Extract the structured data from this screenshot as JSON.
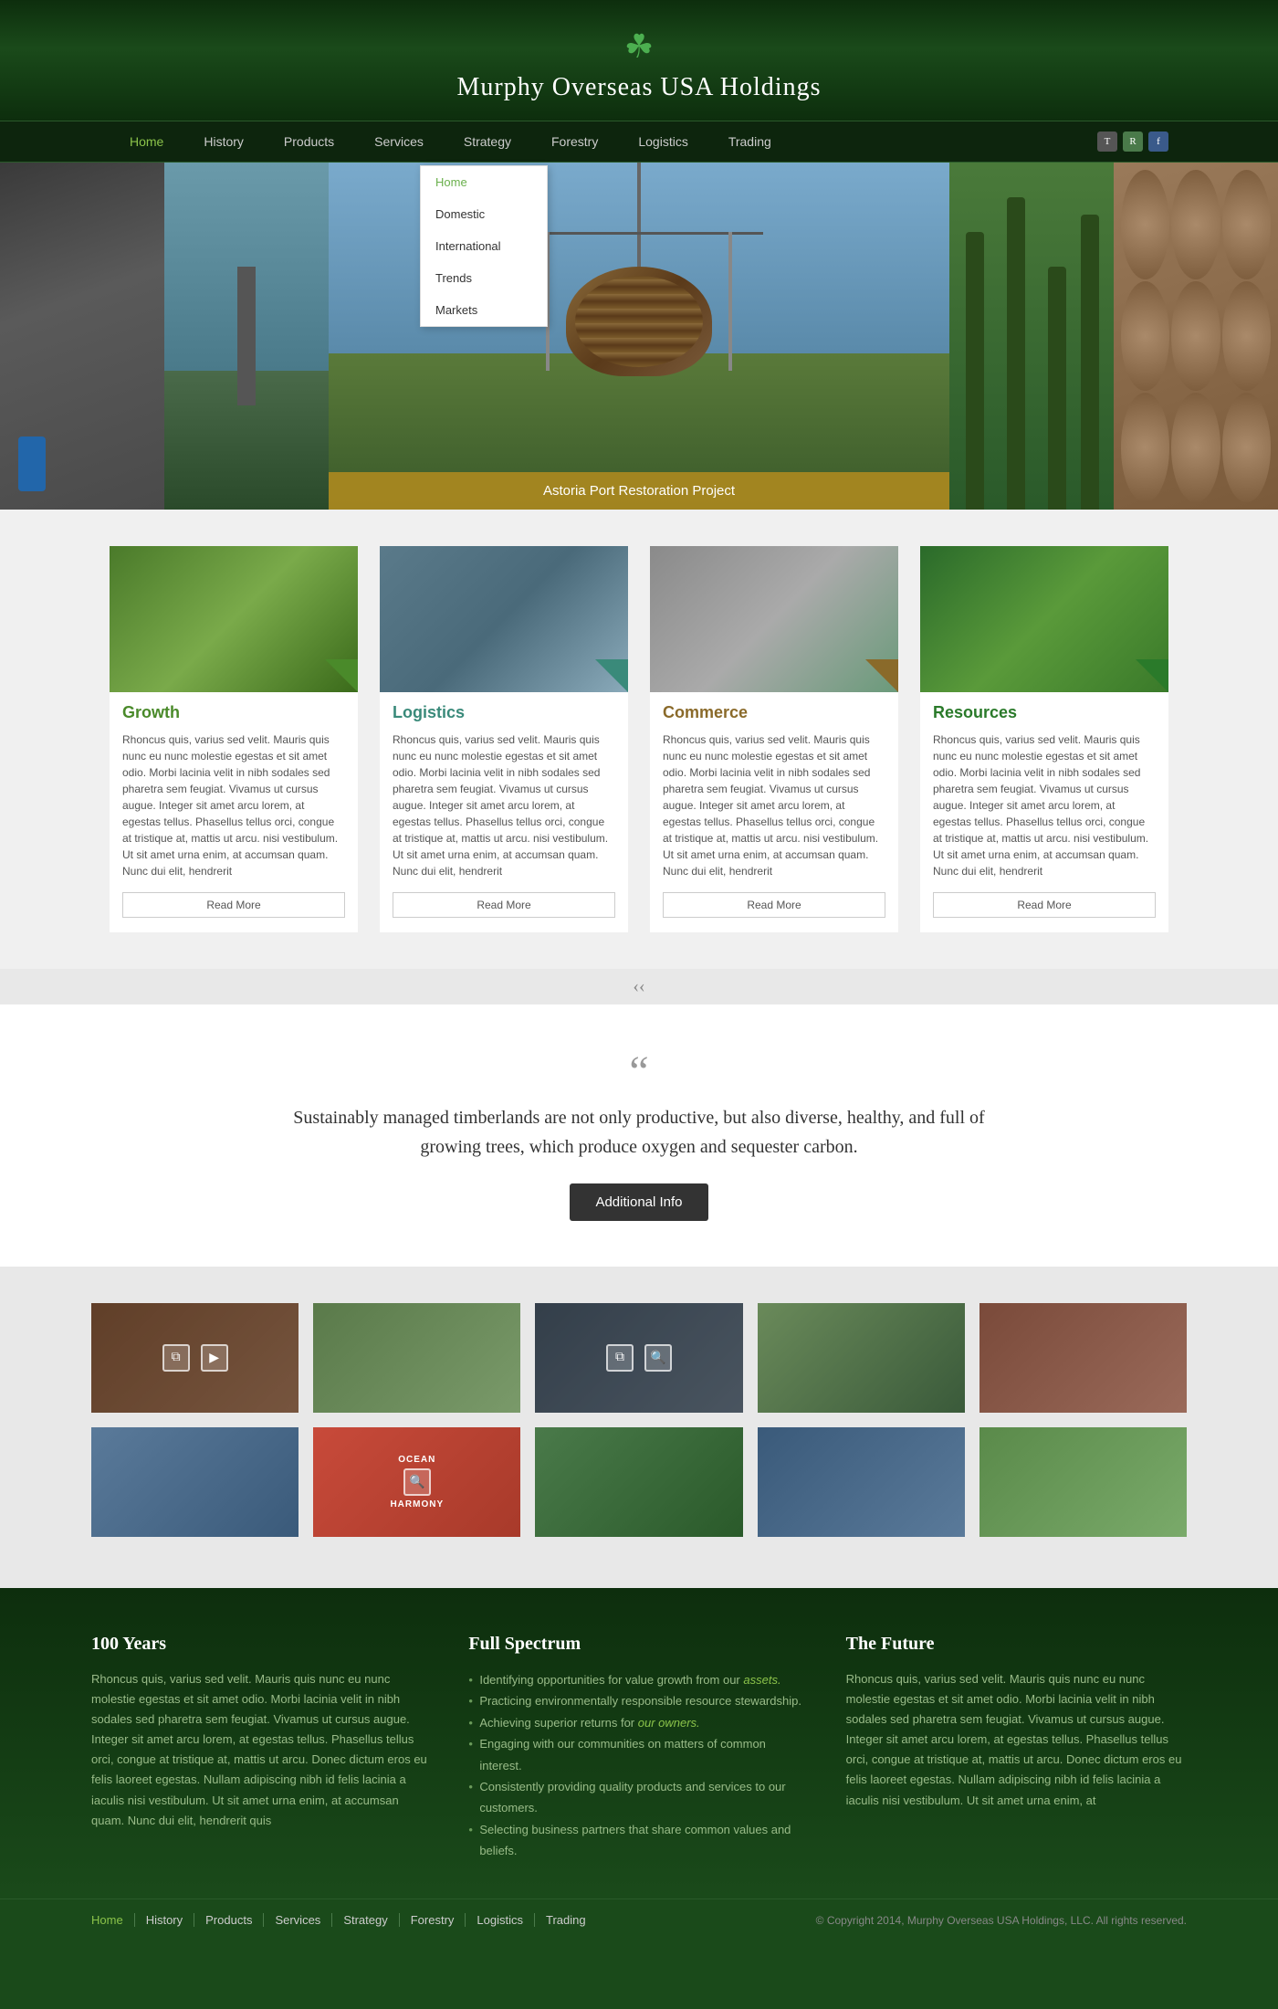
{
  "site": {
    "title": "Murphy Overseas USA Holdings",
    "shamrock": "☘",
    "tagline": "Sustainably managed timberlands are not only productive, but also diverse, healthy, and full of growing trees, which produce oxygen and sequester carbon."
  },
  "nav": {
    "items": [
      {
        "label": "Home",
        "active": true
      },
      {
        "label": "History"
      },
      {
        "label": "Products"
      },
      {
        "label": "Services"
      },
      {
        "label": "Strategy"
      },
      {
        "label": "Forestry"
      },
      {
        "label": "Logistics"
      },
      {
        "label": "Trading"
      }
    ],
    "social": [
      "T",
      "R",
      "f"
    ]
  },
  "dropdown": {
    "items": [
      {
        "label": "Home",
        "active": true
      },
      {
        "label": "Domestic"
      },
      {
        "label": "International"
      },
      {
        "label": "Trends"
      },
      {
        "label": "Markets"
      }
    ]
  },
  "hero": {
    "caption": "Astoria Port Restoration Project"
  },
  "cards": [
    {
      "title": "Growth",
      "colorClass": "green",
      "cornerClass": "green",
      "imgClass": "trees",
      "text": "Rhoncus quis, varius sed velit. Mauris quis nunc eu nunc molestie egestas et sit amet odio. Morbi lacinia velit in nibh sodales sed pharetra sem feugiat. Vivamus ut cursus augue. Integer sit amet arcu lorem, at egestas tellus. Phasellus tellus orci, congue at tristique at, mattis ut arcu.  nisi vestibulum. Ut sit amet urna enim, at accumsan quam. Nunc dui elit, hendrerit",
      "readMore": "Read More"
    },
    {
      "title": "Logistics",
      "colorClass": "teal",
      "cornerClass": "teal",
      "imgClass": "port",
      "text": "Rhoncus quis, varius sed velit. Mauris quis nunc eu nunc molestie egestas et sit amet odio. Morbi lacinia velit in nibh sodales sed pharetra sem feugiat. Vivamus ut cursus augue. Integer sit amet arcu lorem, at egestas tellus. Phasellus tellus orci, congue at tristique at, mattis ut arcu.  nisi vestibulum. Ut sit amet urna enim, at accumsan quam. Nunc dui elit, hendrerit",
      "readMore": "Read More"
    },
    {
      "title": "Commerce",
      "colorClass": "orange",
      "cornerClass": "orange",
      "imgClass": "commerce",
      "text": "Rhoncus quis, varius sed velit. Mauris quis nunc eu nunc molestie egestas et sit amet odio. Morbi lacinia velit in nibh sodales sed pharetra sem feugiat. Vivamus ut cursus augue. Integer sit amet arcu lorem, at egestas tellus. Phasellus tellus orci, congue at tristique at, mattis ut arcu.  nisi vestibulum. Ut sit amet urna enim, at accumsan quam. Nunc dui elit, hendrerit",
      "readMore": "Read More"
    },
    {
      "title": "Resources",
      "colorClass": "darkgreen",
      "cornerClass": "darkgreen",
      "imgClass": "forest",
      "text": "Rhoncus quis, varius sed velit. Mauris quis nunc eu nunc molestie egestas et sit amet odio. Morbi lacinia velit in nibh sodales sed pharetra sem feugiat. Vivamus ut cursus augue. Integer sit amet arcu lorem, at egestas tellus. Phasellus tellus orci, congue at tristique at, mattis ut arcu.  nisi vestibulum. Ut sit amet urna enim, at accumsan quam. Nunc dui elit, hendrerit",
      "readMore": "Read More"
    }
  ],
  "quote": {
    "mark": "“",
    "text": "Sustainably managed timberlands are not only productive, but also diverse, healthy, and full of growing trees, which produce oxygen and sequester carbon.",
    "button": "Additional Info"
  },
  "gallery": {
    "rows": [
      [
        {
          "class": "g1",
          "hasOverlay": true,
          "icons": [
            "link-icon",
            "play-icon"
          ]
        },
        {
          "class": "g2",
          "hasOverlay": false
        },
        {
          "class": "g3",
          "hasOverlay": true,
          "icons": [
            "link-icon",
            "search-icon"
          ]
        },
        {
          "class": "g4",
          "hasOverlay": false
        },
        {
          "class": "g5",
          "hasOverlay": false
        }
      ],
      [
        {
          "class": "g6",
          "hasOverlay": false
        },
        {
          "class": "g7",
          "hasOverlay": true,
          "icons": [
            "search-icon"
          ]
        },
        {
          "class": "g8",
          "hasOverlay": false
        },
        {
          "class": "g9",
          "hasOverlay": false
        },
        {
          "class": "g10",
          "hasOverlay": false
        }
      ]
    ]
  },
  "footer": {
    "col1": {
      "title": "100 Years",
      "text": "Rhoncus quis, varius sed velit. Mauris quis nunc eu nunc molestie egestas et sit amet odio. Morbi lacinia velit in nibh sodales sed pharetra sem feugiat. Vivamus ut cursus augue. Integer sit amet arcu lorem, at egestas tellus. Phasellus tellus orci, congue at tristique at, mattis ut arcu. Donec dictum eros eu felis laoreet egestas. Nullam adipiscing nibh id felis lacinia a iaculis nisi vestibulum. Ut sit amet urna enim, at accumsan quam. Nunc dui elit, hendrerit quis"
    },
    "col2": {
      "title": "Full Spectrum",
      "items": [
        {
          "text": "Identifying opportunities for value growth from our ",
          "highlight": "assets."
        },
        {
          "text": "Practicing environmentally responsible resource stewardship."
        },
        {
          "text": "Achieving superior returns for ",
          "highlight": "our owners."
        },
        {
          "text": "Engaging with our communities on matters of common interest."
        },
        {
          "text": "Consistently providing quality products and services to our customers."
        },
        {
          "text": "Selecting business partners that share common values and beliefs."
        }
      ]
    },
    "col3": {
      "title": "The Future",
      "text": "Rhoncus quis, varius sed velit. Mauris quis nunc eu nunc molestie egestas et sit amet odio. Morbi lacinia velit in nibh sodales sed pharetra sem feugiat. Vivamus ut cursus augue. Integer sit amet arcu lorem, at egestas tellus. Phasellus tellus orci, congue at tristique at, mattis ut arcu. Donec dictum eros eu felis laoreet egestas. Nullam adipiscing nibh id felis lacinia a iaculis nisi vestibulum. Ut sit amet urna enim, at"
    }
  },
  "footerNav": {
    "items": [
      {
        "label": "Home",
        "active": true
      },
      {
        "label": "History"
      },
      {
        "label": "Products"
      },
      {
        "label": "Services"
      },
      {
        "label": "Strategy"
      },
      {
        "label": "Forestry"
      },
      {
        "label": "Logistics"
      },
      {
        "label": "Trading"
      }
    ],
    "copyright": "© Copyright 2014, Murphy Overseas USA Holdings, LLC. All rights reserved."
  }
}
